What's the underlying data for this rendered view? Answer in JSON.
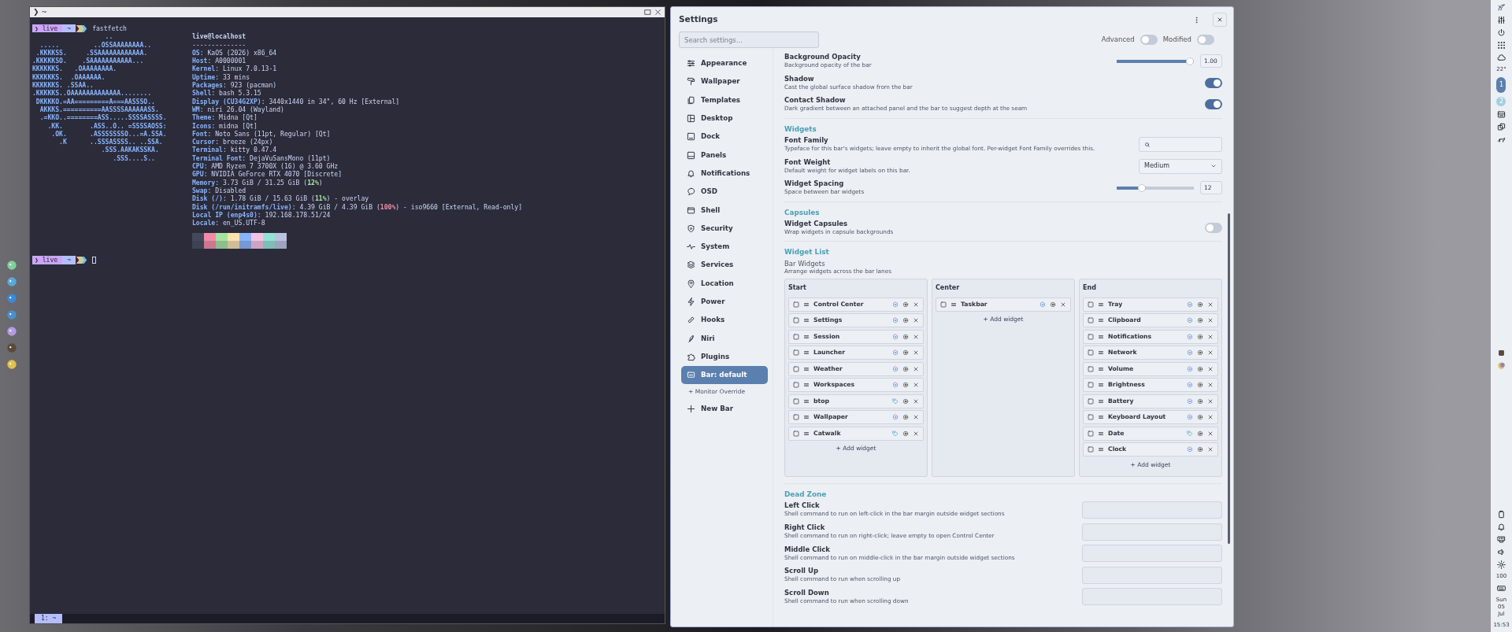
{
  "terminal": {
    "title": "❯ ~",
    "prompts": [
      {
        "user": "❯ live",
        "dir": "~",
        "command": "fastfetch"
      },
      {
        "user": "❯ live",
        "dir": "~"
      }
    ],
    "logo": [
      "                   ..",
      "  .....         ..OSSAAAAAAAA..",
      " .KKKKSS.     .SSAAAAAAAAAAAA.",
      ".KKKKKSO.    .SAAAAAAAAAAA...",
      "KKKKKKS.   .OAAAAAAAA.",
      "KKKKKKS.  .OAAAAAA.",
      "KKKKKKS. .SSAA..",
      ".KKKKKS..OAAAAAAAAAAAAA........",
      " DKKKKO.=AA=========A===AASSSO..",
      "  AKKKS.==========AASSSSAAAAAASS.",
      "  .=KKO..========ASS.....SSSSASSSS.",
      "    .KK.       .ASS..O.. =SSSSAOSS:",
      "     .OK.      .ASSSSSSSO...=A.SSA.",
      "       .K      ..SSSASSSS.. ..SSA.",
      "                  .SSS.AAKAKSSKA.",
      "                     .SSS....S.."
    ],
    "host": "live@localhost",
    "separator": "--------------",
    "fields": [
      {
        "line": "**OS**: KaOS (2026) x86_64"
      },
      {
        "line": "**Host**: A0000001"
      },
      {
        "line": "**Kernel**: Linux 7.0.13-1"
      },
      {
        "line": "**Uptime**: 33 mins"
      },
      {
        "line": "**Packages**: 923 (pacman)"
      },
      {
        "line": "**Shell**: bash 5.3.15"
      },
      {
        "line": "**Display (CU34G2XP)**: 3440x1440 in 34\", 60 Hz [External]"
      },
      {
        "line": "**WM**: niri 26.04 (Wayland)"
      },
      {
        "line": "**Theme**: Midna [Qt]"
      },
      {
        "line": "**Icons**: midna [Qt]"
      },
      {
        "line": "**Font**: Noto Sans (11pt, Regular) [Qt]"
      },
      {
        "line": "**Cursor**: breeze (24px)"
      },
      {
        "line": "**Terminal**: kitty 0.47.4"
      },
      {
        "line": "**Terminal Font**: DejaVuSansMono (11pt)"
      },
      {
        "line": "**CPU**: AMD Ryzen 7 3700X (16) @ 3.60 GHz"
      },
      {
        "line": "**GPU**: NVIDIA GeForce RTX 4070 [Discrete]"
      },
      {
        "line": "**Memory**: 3.73 GiB / 31.25 GiB (",
        "percent": "12%",
        "color": "#a6e3a1",
        "suffix": ")"
      },
      {
        "line": "**Swap**: Disabled"
      },
      {
        "line": "**Disk (/)**: 1.78 GiB / 15.63 GiB (",
        "percent": "11%",
        "color": "#a6e3a1",
        "suffix": ") - overlay"
      },
      {
        "line": "**Disk (/run/initramfs/live)**: 4.39 GiB / 4.39 GiB (",
        "percent": "100%",
        "color": "#f38ba8",
        "suffix": ") - iso9660 [External, Read-only]"
      },
      {
        "line": "**Local IP (enp4s0)**: 192.168.178.51/24"
      },
      {
        "line": "**Locale**: en_US.UTF-8"
      }
    ],
    "tab": "1: ~"
  },
  "settings": {
    "title": "Settings",
    "search": {
      "placeholder": "Search settings..."
    },
    "filters": [
      {
        "label": "Advanced",
        "on": false
      },
      {
        "label": "Modified",
        "on": false
      }
    ],
    "sidebar": [
      {
        "label": "Appearance",
        "selected": false
      },
      {
        "label": "Wallpaper",
        "selected": false
      },
      {
        "label": "Templates",
        "selected": false
      },
      {
        "label": "Desktop",
        "selected": false
      },
      {
        "label": "Dock",
        "selected": false
      },
      {
        "label": "Panels",
        "selected": false
      },
      {
        "label": "Notifications",
        "selected": false
      },
      {
        "label": "OSD",
        "selected": false
      },
      {
        "label": "Shell",
        "selected": false
      },
      {
        "label": "Security",
        "selected": false
      },
      {
        "label": "System",
        "selected": false
      },
      {
        "label": "Services",
        "selected": false
      },
      {
        "label": "Location",
        "selected": false
      },
      {
        "label": "Power",
        "selected": false
      },
      {
        "label": "Hooks",
        "selected": false
      },
      {
        "label": "Niri",
        "selected": false
      },
      {
        "label": "Plugins",
        "selected": false
      },
      {
        "label": "Bar: default",
        "selected": true
      }
    ],
    "monitor_override": "+ Monitor Override",
    "new_bar": "New Bar",
    "rows_top": [
      {
        "kind": "slider",
        "title": "Background Opacity",
        "desc": "Background opacity of the bar",
        "level": 1.0,
        "reading": "1.00"
      },
      {
        "kind": "toggle",
        "title": "Shadow",
        "desc": "Cast the global surface shadow from the bar",
        "on": true
      },
      {
        "kind": "toggle",
        "title": "Contact Shadow",
        "desc": "Dark gradient between an attached panel and the bar to suggest depth at the seam",
        "on": true
      },
      {
        "kind": "section",
        "title": "Widgets"
      },
      {
        "kind": "search",
        "title": "Font Family",
        "desc": "Typeface for this bar's widgets; leave empty to inherit the global font. Per-widget Font Family overrides this."
      },
      {
        "kind": "select",
        "title": "Font Weight",
        "desc": "Default weight for widget labels on this bar.",
        "value": "Medium"
      },
      {
        "kind": "slider",
        "title": "Widget Spacing",
        "desc": "Space between bar widgets",
        "level": 0.38,
        "reading": "12"
      },
      {
        "kind": "section",
        "title": "Capsules"
      },
      {
        "kind": "toggle",
        "title": "Widget Capsules",
        "desc": "Wrap widgets in capsule backgrounds",
        "on": false
      },
      {
        "kind": "section",
        "title": "Widget List"
      }
    ],
    "widget_list": {
      "title": "Bar Widgets",
      "desc": "Arrange widgets across the bar lanes",
      "lanes": [
        {
          "name": "Start",
          "add_label": "+ Add widget",
          "widgets": [
            {
              "name": "Control Center",
              "kind": "builtin",
              "checked": false
            },
            {
              "name": "Settings",
              "kind": "builtin",
              "checked": false
            },
            {
              "name": "Session",
              "kind": "builtin",
              "checked": false
            },
            {
              "name": "Launcher",
              "kind": "builtin",
              "checked": false
            },
            {
              "name": "Weather",
              "kind": "builtin",
              "checked": false
            },
            {
              "name": "Workspaces",
              "kind": "builtin",
              "checked": false
            },
            {
              "name": "btop",
              "kind": "tagged",
              "checked": false
            },
            {
              "name": "Wallpaper",
              "kind": "builtin",
              "checked": false
            },
            {
              "name": "Catwalk",
              "kind": "tagged",
              "checked": false
            }
          ]
        },
        {
          "name": "Center",
          "add_label": "+ Add widget",
          "widgets": [
            {
              "name": "Taskbar",
              "kind": "builtin",
              "checked": false
            }
          ]
        },
        {
          "name": "End",
          "add_label": "+ Add widget",
          "widgets": [
            {
              "name": "Tray",
              "kind": "builtin",
              "checked": false
            },
            {
              "name": "Clipboard",
              "kind": "builtin",
              "checked": false
            },
            {
              "name": "Notifications",
              "kind": "builtin",
              "checked": false
            },
            {
              "name": "Network",
              "kind": "builtin",
              "checked": false
            },
            {
              "name": "Volume",
              "kind": "builtin",
              "checked": false
            },
            {
              "name": "Brightness",
              "kind": "builtin",
              "checked": false
            },
            {
              "name": "Battery",
              "kind": "builtin",
              "checked": false
            },
            {
              "name": "Keyboard Layout",
              "kind": "builtin",
              "checked": false
            },
            {
              "name": "Date",
              "kind": "tagged",
              "checked": false
            },
            {
              "name": "Clock",
              "kind": "builtin",
              "checked": false
            }
          ]
        }
      ]
    },
    "dead_zone": {
      "title": "Dead Zone",
      "rows": [
        {
          "title": "Left Click",
          "desc": "Shell command to run on left-click in the bar margin outside widget sections"
        },
        {
          "title": "Right Click",
          "desc": "Shell command to run on right-click; leave empty to open Control Center"
        },
        {
          "title": "Middle Click",
          "desc": "Shell command to run on middle-click in the bar margin outside widget sections"
        },
        {
          "title": "Scroll Up",
          "desc": "Shell command to run when scrolling up"
        },
        {
          "title": "Scroll Down",
          "desc": "Shell command to run when scrolling down"
        }
      ]
    }
  },
  "panel": {
    "temperature": "22°",
    "workspaces": [
      {
        "label": "1",
        "selected": true
      },
      {
        "label": "2",
        "selected": false
      }
    ],
    "brightness": "100",
    "date": [
      "Sun",
      "05",
      "Jul"
    ],
    "time": "15:53"
  }
}
